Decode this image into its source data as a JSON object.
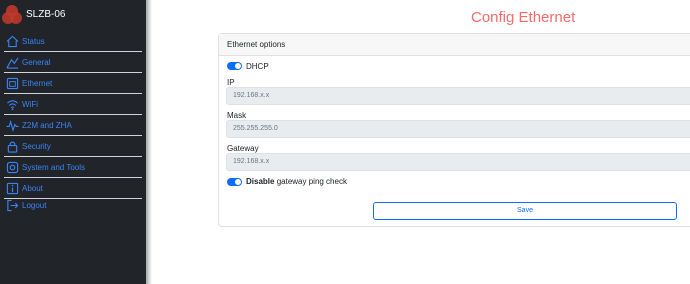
{
  "sidebar": {
    "brand": "SLZB-06",
    "items": [
      {
        "label": "Status",
        "icon": "home-icon"
      },
      {
        "label": "General",
        "icon": "general-icon"
      },
      {
        "label": "Ethernet",
        "icon": "ethernet-icon"
      },
      {
        "label": "WiFi",
        "icon": "wifi-icon"
      },
      {
        "label": "Z2M and ZHA",
        "icon": "pulse-icon"
      },
      {
        "label": "Security",
        "icon": "lock-icon"
      },
      {
        "label": "System and Tools",
        "icon": "gear-icon"
      },
      {
        "label": "About",
        "icon": "info-icon"
      },
      {
        "label": "Logout",
        "icon": "logout-icon"
      }
    ]
  },
  "main": {
    "title": "Config Ethernet",
    "card_title": "Ethernet options",
    "dhcp_label": "DHCP",
    "ip_label": "IP",
    "ip_value": "192.168.x.x",
    "mask_label": "Mask",
    "mask_value": "255.255.255.0",
    "gateway_label": "Gateway",
    "gateway_value": "192.168.x.x",
    "ping_bold": "Disable",
    "ping_rest": " gateway ping check",
    "save_label": "Save"
  },
  "colors": {
    "accent": "#0d6efd",
    "title": "#f56b6b",
    "sidebar_bg": "#212529",
    "logo": "#c0392b"
  }
}
